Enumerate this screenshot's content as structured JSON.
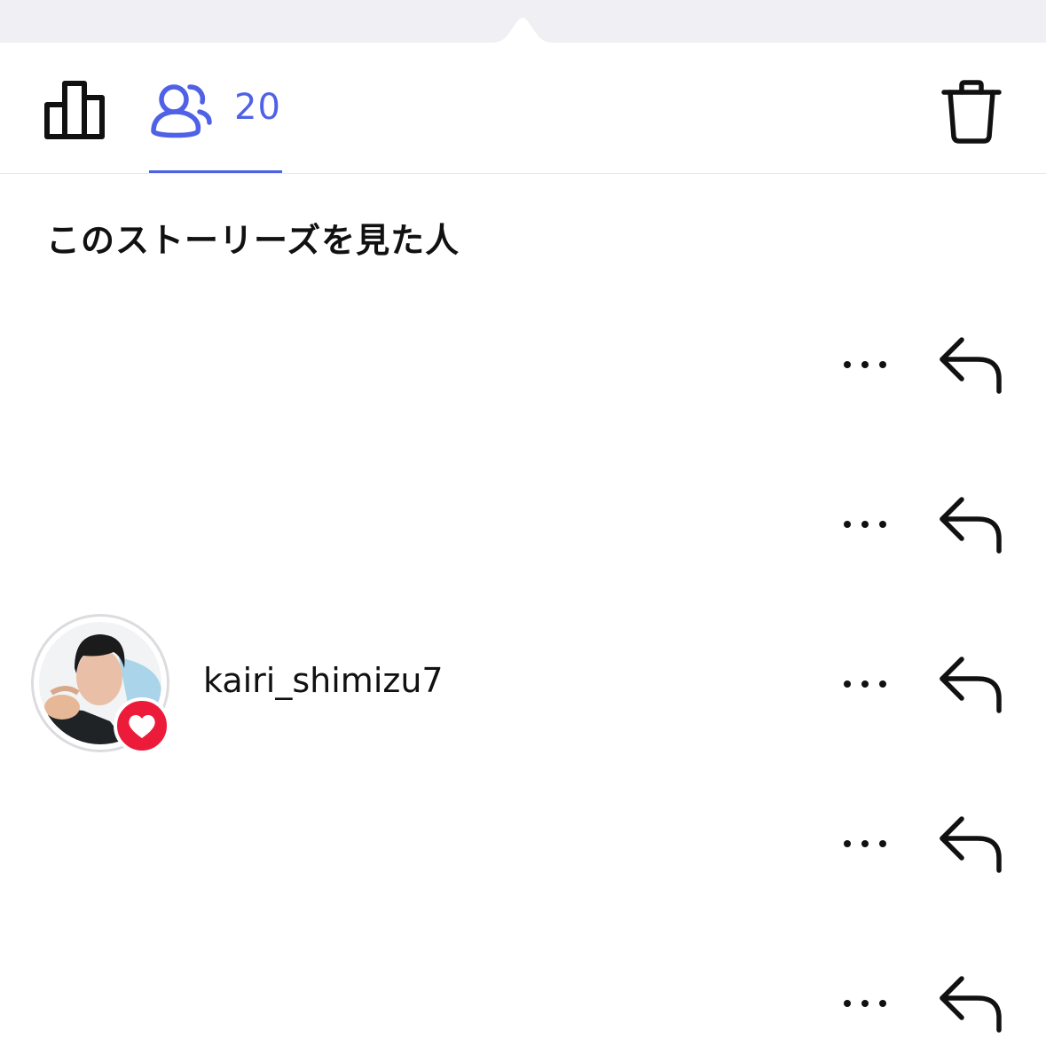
{
  "tabs": {
    "insights_icon": "bar-chart-icon",
    "viewers_icon": "people-icon",
    "viewers_count": "20",
    "active_color": "#4f61e6"
  },
  "actions": {
    "delete_icon": "trash-icon"
  },
  "section": {
    "title": "このストーリーズを見た人"
  },
  "viewers": [
    {
      "username": "",
      "liked": false
    },
    {
      "username": "",
      "liked": false
    },
    {
      "username": "kairi_shimizu7",
      "liked": true
    },
    {
      "username": "",
      "liked": false
    },
    {
      "username": "",
      "liked": false
    }
  ],
  "colors": {
    "accent": "#4f61e6",
    "like_badge": "#ed1b3a",
    "text": "#111111"
  }
}
